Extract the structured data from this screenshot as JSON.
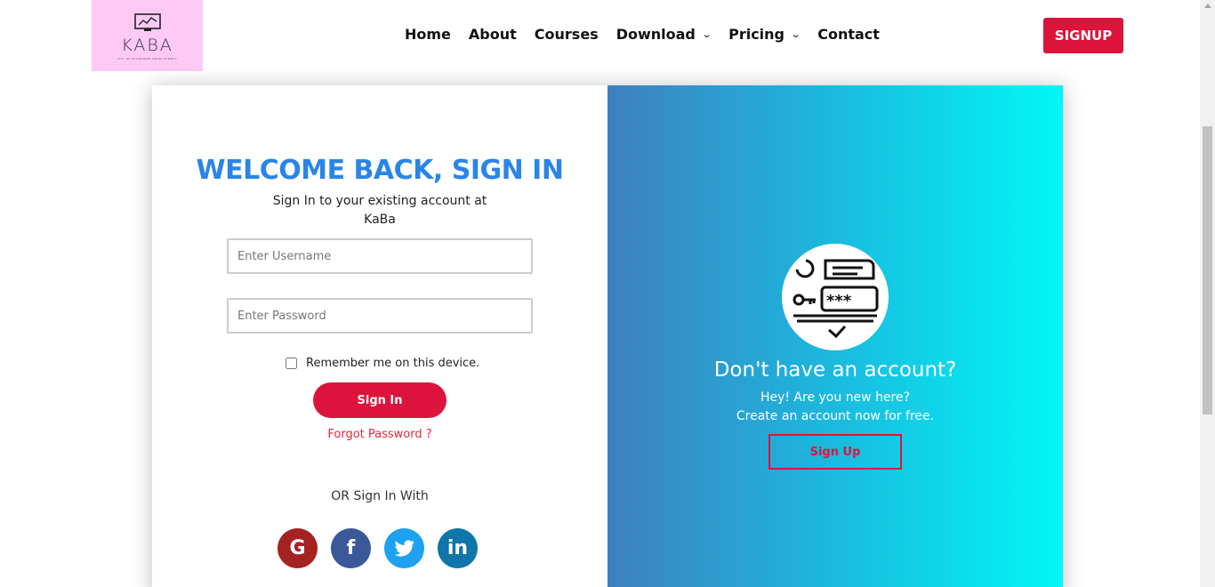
{
  "header": {
    "logo_text": "KABA",
    "logo_tagline": "CITY OF ACHIEVERS DEVELOPMENT",
    "nav": [
      {
        "label": "Home",
        "dropdown": false
      },
      {
        "label": "About",
        "dropdown": false
      },
      {
        "label": "Courses",
        "dropdown": false
      },
      {
        "label": "Download",
        "dropdown": true
      },
      {
        "label": "Pricing",
        "dropdown": true
      },
      {
        "label": "Contact",
        "dropdown": false
      }
    ],
    "signup_label": "SIGNUP"
  },
  "signin": {
    "title": "WELCOME BACK, SIGN IN",
    "subtitle": "Sign In to your existing account at KaBa",
    "username_placeholder": "Enter Username",
    "password_placeholder": "Enter Password",
    "remember_label": "Remember me on this device.",
    "button_label": "Sign In",
    "forgot_label": "Forgot Password ?",
    "or_label": "OR Sign In With",
    "socials": [
      "google",
      "facebook",
      "twitter",
      "linkedin"
    ]
  },
  "signup_panel": {
    "heading": "Don't have an account?",
    "line1": "Hey! Are you new here?",
    "line2": "Create an account now for free.",
    "button_label": "Sign Up"
  },
  "colors": {
    "accent_red": "#dc143c",
    "title_blue": "#2a85e8",
    "logo_bg": "#ffc9f5",
    "gradient_start": "#3f7fc0",
    "gradient_end": "#00f7f7"
  }
}
